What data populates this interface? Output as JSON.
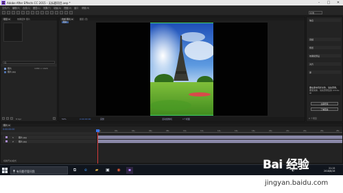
{
  "window": {
    "logo": "Ae",
    "title": "Adobe After Effects CC 2015 - 无标题项目.aep *",
    "controls": [
      "–",
      "□",
      "✕"
    ]
  },
  "menu": [
    "文件(F)",
    "编辑(E)",
    "合成(C)",
    "图层(L)",
    "效果(T)",
    "动画(A)",
    "视图(V)",
    "窗口",
    "帮助(H)"
  ],
  "toolbar": {
    "workspace": "标准"
  },
  "project": {
    "tabs": [
      "项目 ≡",
      "效果控件 照片"
    ],
    "items": [
      {
        "name": "照片",
        "size": "1080 × 1920"
      },
      {
        "name": "照片.jpg",
        "size": ""
      }
    ],
    "footer": "8 bpc"
  },
  "viewer": {
    "tabs": [
      "合成 照片 ≡",
      "图层 (无)"
    ],
    "subtab": "照片",
    "zoom": "50%",
    "timecode": "0:00:00:00",
    "resolution": "完整",
    "camera": "活动摄像机",
    "views": "1个视图"
  },
  "right_panel": {
    "sections": [
      "信息",
      "音频",
      "预览",
      "效果和预设",
      "对齐",
      "库"
    ],
    "notice_title": "要在库中同步文件，请先登录。",
    "notice_body": "要使用库，请先登录您的 Adobe ID",
    "btn_signin": "立即登录",
    "btn_learn": "了解更多",
    "footer": "0 个项目"
  },
  "timeline": {
    "tab": "照片 ≡",
    "timecode": "0:00:00:00",
    "layers": [
      {
        "num": "1",
        "name": "照片.jpg"
      },
      {
        "num": "2",
        "name": "照片.jpg"
      }
    ],
    "ticks": [
      "0s",
      "02s",
      "04s",
      "06s",
      "08s",
      "10s",
      "12s",
      "14s",
      "16s",
      "18s",
      "20s",
      "22s",
      "24s",
      "26s",
      "28s"
    ],
    "switches_label": "切换开关/模式"
  },
  "taskbar": {
    "search_placeholder": "有问题尽管问我",
    "time": "21:15",
    "date": "2018/8/16"
  },
  "watermark": {
    "brand": "Bai 经验",
    "url": "jingyan.baidu.com"
  }
}
